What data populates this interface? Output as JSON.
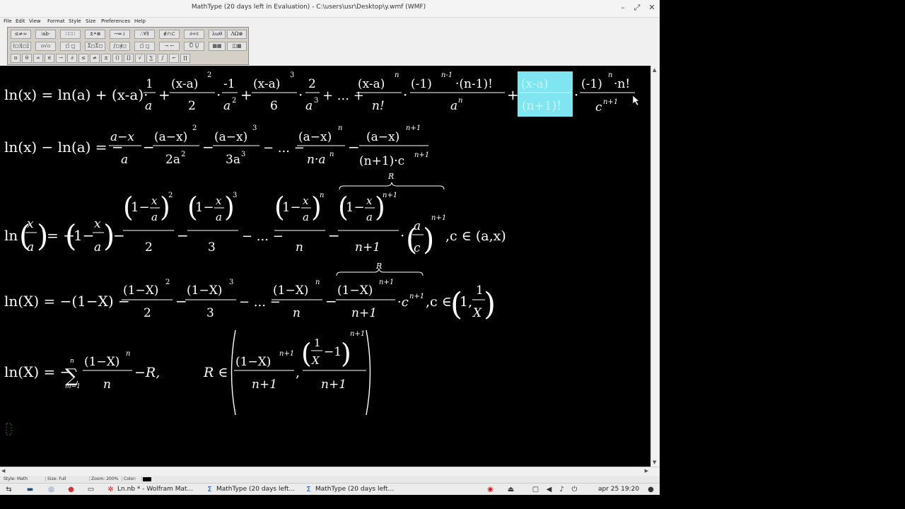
{
  "window": {
    "title": "MathType (20 days left in Evaluation) - C:\\users\\usr\\Desktop\\y.wmf (WMF)",
    "minimize": "–",
    "restore": "⤢",
    "close": "✕"
  },
  "menu": [
    "File",
    "Edit",
    "View",
    "Format",
    "Style",
    "Size",
    "Preferences",
    "Help"
  ],
  "palette": {
    "row1": [
      "≤≠≈",
      "⁝ab·",
      "∷∷∷",
      "±•⊗",
      "→⇔↓",
      "∴∀∃",
      "∉∩⊂",
      "∂∞ℓ",
      "λωθ",
      "ΛΩ⊗"
    ],
    "row2": [
      "(◻)[◻]",
      "▫√▫",
      "◻̅ ◻̲",
      "Σ◻Σ◻",
      "∫◻∮◻",
      "◻̄ ◻̲",
      "→ ←",
      "Ů Ų",
      "▦▦",
      "◫▦"
    ],
    "row3": [
      "π",
      "θ",
      "∞",
      "∈",
      "→",
      "∂",
      "≤",
      "≠",
      "±",
      "()",
      "[]",
      "√",
      "∑",
      "∫",
      "⌐",
      "∏"
    ]
  },
  "equations": {
    "eq1": {
      "lhs": "ln(x) = ln(a) + (x-a)·",
      "t1n": "1",
      "t1d": "a",
      "t2n": "(x-a)",
      "t2p": "2",
      "t2d": "2",
      "t2b": "-1",
      "t2bd": "a",
      "t2bp": "2",
      "t3n": "(x-a)",
      "t3p": "3",
      "t3d": "6",
      "t3b": "2",
      "t3bd": "a",
      "t3bp": "3",
      "dots": "+ ... +",
      "tnn": "(x-a)",
      "tnp": "n",
      "tnd": "n!",
      "tnb": "(-1)",
      "tnbp": "n-1",
      "tnbm": "·(n-1)!",
      "tnbd": "a",
      "tnbdp": "n",
      "sel_n": "(x-a)",
      "sel_d": "(n+1)!",
      "last_n": "(-1)",
      "last_np": "n",
      "last_nm": "·n!",
      "last_d": "c",
      "last_dp": "n+1"
    },
    "eq2": {
      "lhs": "ln(x) − ln(a) = −",
      "t1n": "a−x",
      "t1d": "a",
      "t2n": "(a−x)",
      "t2p": "2",
      "t2d": "2a",
      "t2dp": "2",
      "t3n": "(a−x)",
      "t3p": "3",
      "t3d": "3a",
      "t3dp": "3",
      "dots": "− ... −",
      "tnn": "(a−x)",
      "tnp": "n",
      "tnd": "n·a",
      "tndp": "n",
      "tln": "(a−x)",
      "tlp": "n+1",
      "tld": "(n+1)·c",
      "tldp": "n+1"
    },
    "eq3": {
      "lhs": "ln",
      "fx": "x",
      "fa": "a",
      "eqs": "= −",
      "one": "1−",
      "p2": "2",
      "d2": "2",
      "p3": "3",
      "d3": "3",
      "pn": "n",
      "dn": "n",
      "pl": "n+1",
      "dl": "n+1",
      "R": "R",
      "ac_n": "a",
      "ac_d": "c",
      "ac_p": "n+1",
      "cond": ",c ∈ (a,x)"
    },
    "eq4": {
      "lhs": "ln(X) = −(1−X) −",
      "t2n": "(1−X)",
      "t2p": "2",
      "t2d": "2",
      "t3n": "(1−X)",
      "t3p": "3",
      "t3d": "3",
      "dots": "− ... −",
      "tnn": "(1−X)",
      "tnp": "n",
      "tnd": "n",
      "tln": "(1−X)",
      "tlp": "n+1",
      "tld": "n+1",
      "cm": "·c",
      "cp": "n+1",
      "R": "R",
      "cond": ",c ∈",
      "one": "1,",
      "xn": "1",
      "xd": "X"
    },
    "eq5": {
      "lhs": "ln(X) = −",
      "sum": "∑",
      "sumtop": "n",
      "sumbot": "m=1",
      "sn": "(1−X)",
      "sp": "n",
      "sd": "n",
      "tail": "−R,",
      "R": "R ∈",
      "r1n": "(1−X)",
      "r1p": "n+1",
      "r1d": "n+1",
      "comma": ",",
      "r2a": "1",
      "r2b": "X",
      "r2c": "−1",
      "r2p": "n+1",
      "r2d": "n+1"
    }
  },
  "status": [
    "Style: Math",
    "Size: Full",
    "Zoom: 200%",
    "Color:"
  ],
  "taskbar": {
    "items": [
      "Ln.nb * - Wolfram Mat...",
      "MathType (20 days left...",
      "MathType (20 days left..."
    ],
    "clock": "apr 25  19:20"
  },
  "colors": {
    "selection": "#7fe5f0",
    "canvas": "#000000",
    "window": "#f0f0f0"
  }
}
